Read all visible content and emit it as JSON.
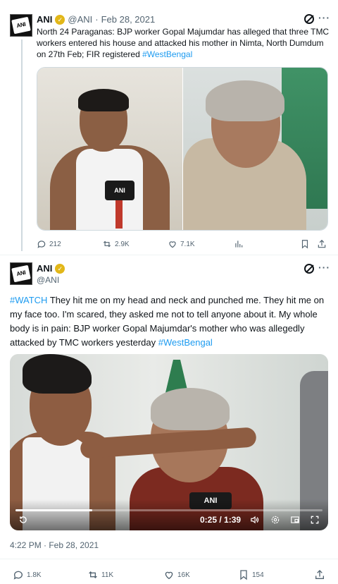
{
  "tweet1": {
    "author_name": "ANI",
    "author_handle": "@ANI",
    "separator": "·",
    "date": "Feb 28, 2021",
    "text_part1": "North 24 Paraganas: BJP worker Gopal Majumdar has alleged that three TMC workers entered his house and attacked his mother in Nimta, North Dumdum on 27th Feb; FIR registered ",
    "hashtag": "#WestBengal",
    "avatar_logo_text": "ANI",
    "mic_logo_text": "ANI",
    "stats": {
      "replies": "212",
      "reposts": "2.9K",
      "likes": "7.1K"
    }
  },
  "tweet2": {
    "author_name": "ANI",
    "author_handle": "@ANI",
    "avatar_logo_text": "ANI",
    "hashtag_watch": "#WATCH",
    "text_main": " They hit me on my head and neck and punched me. They hit me on my face too. I'm scared, they asked me not to tell anyone about it. My whole body is in pain: BJP worker Gopal Majumdar's mother who was allegedly attacked by TMC workers yesterday ",
    "hashtag_wb": "#WestBengal",
    "video": {
      "mic_logo_text": "ANI",
      "time_display": "0:25 / 1:39",
      "progress_fraction": 0.25
    },
    "timestamp": "4:22 PM · Feb 28, 2021",
    "stats": {
      "replies": "1.8K",
      "reposts": "11K",
      "likes": "16K",
      "bookmarks": "154"
    }
  },
  "icons": {
    "verified": "verified-badge-icon",
    "grok": "grok-icon",
    "more": "more-icon",
    "reply": "reply-icon",
    "repost": "repost-icon",
    "like": "like-icon",
    "views": "views-icon",
    "bookmark": "bookmark-icon",
    "share": "share-icon",
    "replay": "replay-icon",
    "volume": "volume-icon",
    "settings": "settings-icon",
    "pip": "pip-icon",
    "fullscreen": "fullscreen-icon"
  },
  "colors": {
    "link": "#1d9bf0",
    "text": "#0f1419",
    "secondary": "#536471",
    "verified_gold": "#e2b719"
  }
}
